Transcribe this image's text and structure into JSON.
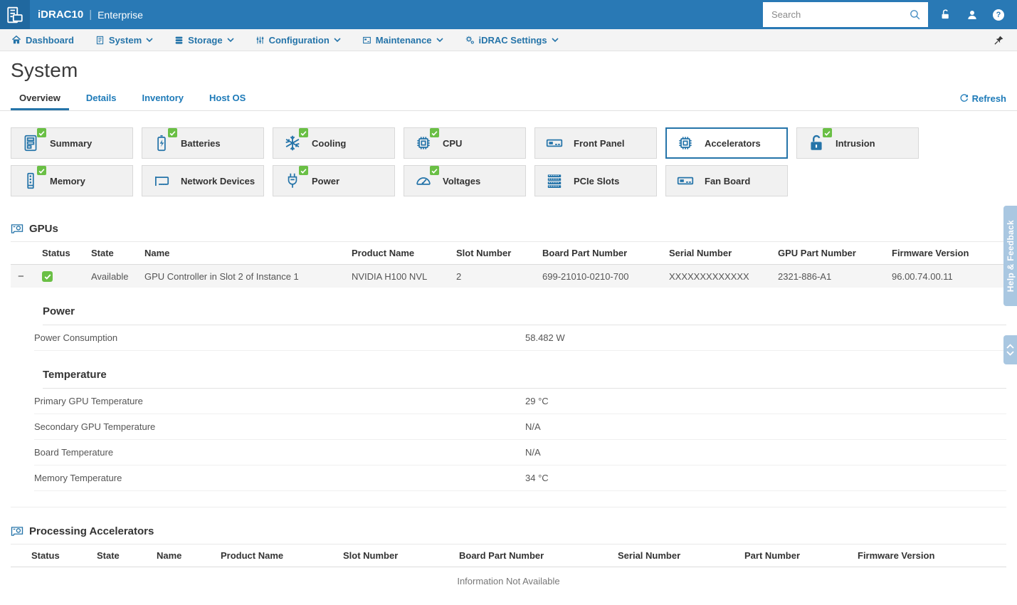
{
  "colors": {
    "header_blue": "#2979b5",
    "accent_blue": "#2574a9",
    "link_blue": "#1d7ab8",
    "check_green": "#6abf45",
    "side_tab_blue": "#a9c7e1",
    "tile_bg": "#f1f1f1",
    "row_bg": "#f5f5f5"
  },
  "header": {
    "brand": "iDRAC10",
    "edition": "Enterprise",
    "search_placeholder": "Search",
    "icons": [
      "search-icon",
      "unlock-icon",
      "user-icon",
      "help-icon"
    ]
  },
  "nav": {
    "items": [
      {
        "label": "Dashboard",
        "icon": "home-icon",
        "dropdown": false
      },
      {
        "label": "System",
        "icon": "system-icon",
        "dropdown": true
      },
      {
        "label": "Storage",
        "icon": "storage-icon",
        "dropdown": true
      },
      {
        "label": "Configuration",
        "icon": "configuration-icon",
        "dropdown": true
      },
      {
        "label": "Maintenance",
        "icon": "maintenance-icon",
        "dropdown": true
      },
      {
        "label": "iDRAC Settings",
        "icon": "gear-icon",
        "dropdown": true
      }
    ],
    "pin_icon": "pin-icon"
  },
  "page": {
    "title": "System",
    "refresh_label": "Refresh",
    "tabs": [
      {
        "label": "Overview",
        "active": true
      },
      {
        "label": "Details",
        "active": false
      },
      {
        "label": "Inventory",
        "active": false
      },
      {
        "label": "Host OS",
        "active": false
      }
    ]
  },
  "tiles": {
    "items": [
      {
        "label": "Summary",
        "icon": "summary-icon",
        "checked": true,
        "selected": false
      },
      {
        "label": "Batteries",
        "icon": "battery-icon",
        "checked": true,
        "selected": false
      },
      {
        "label": "Cooling",
        "icon": "snowflake-icon",
        "checked": true,
        "selected": false
      },
      {
        "label": "CPU",
        "icon": "chip-icon",
        "checked": true,
        "selected": false
      },
      {
        "label": "Front Panel",
        "icon": "panel-icon",
        "checked": false,
        "selected": false
      },
      {
        "label": "Accelerators",
        "icon": "chip-icon",
        "checked": false,
        "selected": true
      },
      {
        "label": "Intrusion",
        "icon": "open-lock-icon",
        "checked": true,
        "selected": false
      },
      {
        "label": "Memory",
        "icon": "memory-icon",
        "checked": true,
        "selected": false
      },
      {
        "label": "Network Devices",
        "icon": "nic-icon",
        "checked": false,
        "selected": false
      },
      {
        "label": "Power",
        "icon": "plug-icon",
        "checked": true,
        "selected": false
      },
      {
        "label": "Voltages",
        "icon": "gauge-icon",
        "checked": true,
        "selected": false
      },
      {
        "label": "PCIe Slots",
        "icon": "slots-icon",
        "checked": false,
        "selected": false
      },
      {
        "label": "Fan Board",
        "icon": "panel-icon",
        "checked": false,
        "selected": false
      }
    ]
  },
  "gpus": {
    "title": "GPUs",
    "title_icon": "gpu-card-icon",
    "columns": [
      "Status",
      "State",
      "Name",
      "Product Name",
      "Slot Number",
      "Board Part Number",
      "Serial Number",
      "GPU Part Number",
      "Firmware Version"
    ],
    "row": {
      "status_icon": "check-icon",
      "state": "Available",
      "name": "GPU Controller in Slot 2 of Instance 1",
      "product_name": "NVIDIA H100 NVL",
      "slot_number": "2",
      "board_part_number": "699-21010-0210-700",
      "serial_number": "XXXXXXXXXXXXX",
      "gpu_part_number": "2321-886-A1",
      "firmware_version": "96.00.74.00.11"
    },
    "details": {
      "power": {
        "title": "Power",
        "rows": [
          {
            "label": "Power Consumption",
            "value": "58.482 W"
          }
        ]
      },
      "temperature": {
        "title": "Temperature",
        "rows": [
          {
            "label": "Primary GPU Temperature",
            "value": "29 °C"
          },
          {
            "label": "Secondary GPU Temperature",
            "value": "N/A"
          },
          {
            "label": "Board Temperature",
            "value": "N/A"
          },
          {
            "label": "Memory Temperature",
            "value": "34 °C"
          }
        ]
      }
    }
  },
  "processing_accelerators": {
    "title": "Processing Accelerators",
    "title_icon": "gpu-card-icon",
    "columns": [
      "Status",
      "State",
      "Name",
      "Product Name",
      "Slot Number",
      "Board Part Number",
      "Serial Number",
      "Part Number",
      "Firmware Version"
    ],
    "empty_message": "Information Not Available"
  },
  "side": {
    "help_feedback_label": "Help & Feedback"
  }
}
